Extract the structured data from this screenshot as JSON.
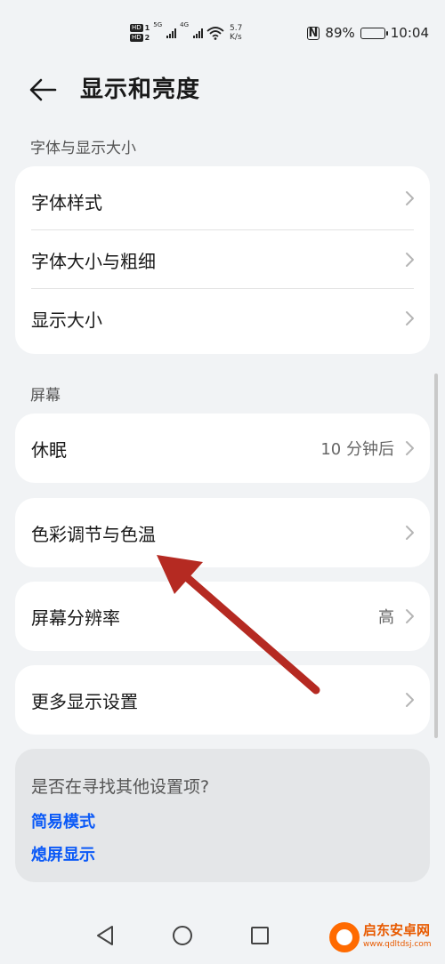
{
  "status_bar": {
    "hd1": "HD",
    "hd1_num": "1",
    "hd2": "HD",
    "hd2_num": "2",
    "net1": "5G",
    "net2": "4G",
    "speed_value": "5.7",
    "speed_unit": "K/s",
    "nfc": "N",
    "battery": "89%",
    "battery_level": 0.89,
    "time": "10:04"
  },
  "header": {
    "back_icon": "back-arrow-icon",
    "title": "显示和亮度"
  },
  "sections": {
    "font_label": "字体与显示大小",
    "screen_label": "屏幕"
  },
  "font_card": {
    "items": [
      {
        "label": "字体样式"
      },
      {
        "label": "字体大小与粗细"
      },
      {
        "label": "显示大小"
      }
    ]
  },
  "screen_items": {
    "sleep": {
      "label": "休眠",
      "value": "10 分钟后"
    },
    "color": {
      "label": "色彩调节与色温"
    },
    "resolution": {
      "label": "屏幕分辨率",
      "value": "高"
    },
    "more": {
      "label": "更多显示设置"
    }
  },
  "suggestion": {
    "question": "是否在寻找其他设置项?",
    "links": [
      "简易模式",
      "熄屏显示"
    ]
  },
  "navbar": {
    "icons": [
      "nav-back-icon",
      "nav-home-icon",
      "nav-recents-icon"
    ]
  },
  "watermark": {
    "name": "启东安卓网",
    "url": "www.qdltdsj.com"
  },
  "colors": {
    "accent": "#0a59f7",
    "annotation_arrow": "#b52a22",
    "background": "#f1f3f5",
    "card": "#ffffff"
  }
}
